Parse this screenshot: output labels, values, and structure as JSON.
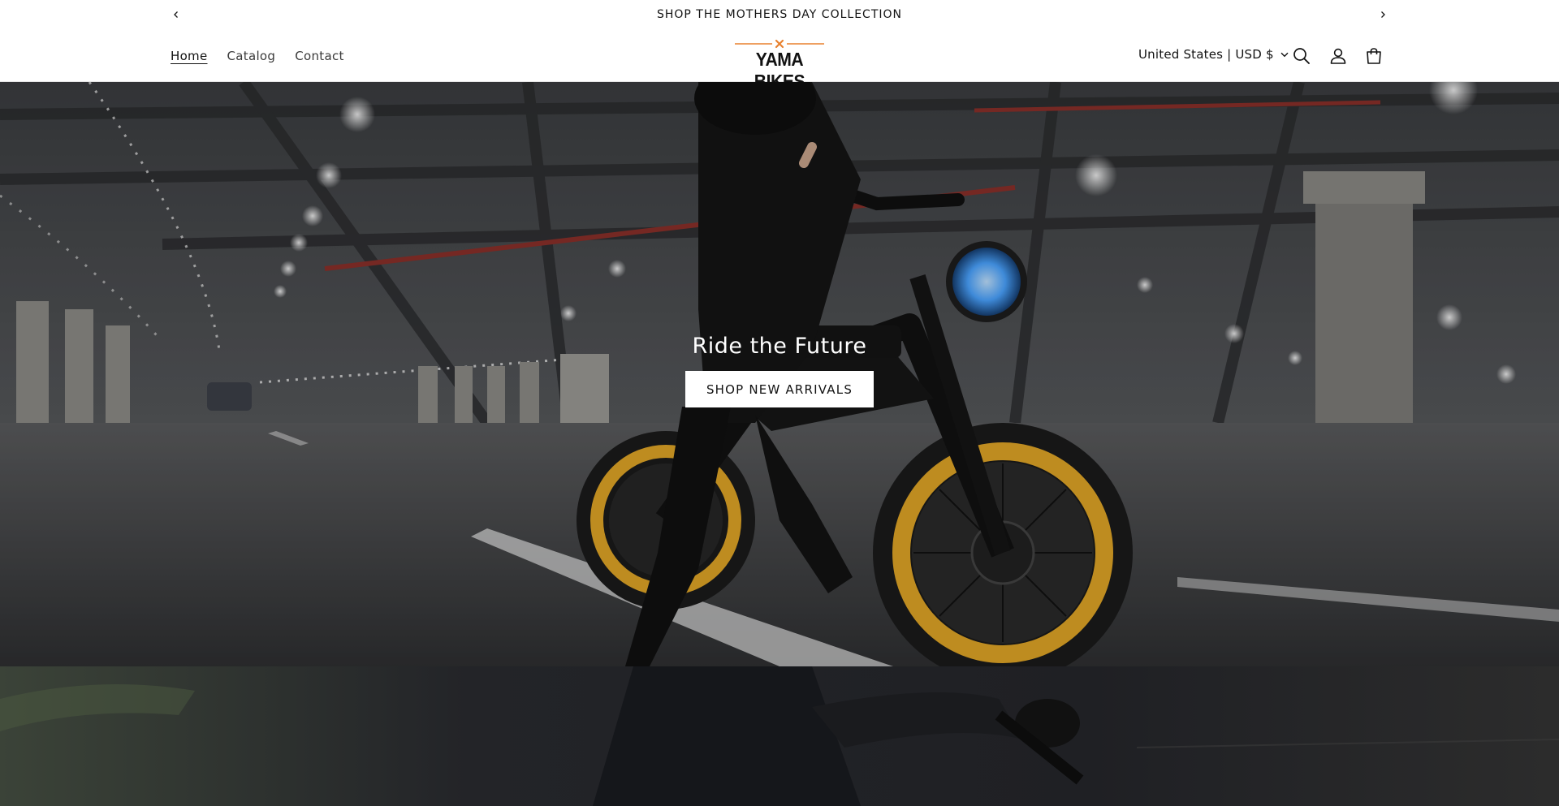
{
  "announcement": {
    "text": "SHOP THE MOTHERS DAY COLLECTION",
    "prev_icon": "chevron-left-icon",
    "next_icon": "chevron-right-icon"
  },
  "header": {
    "nav": [
      {
        "label": "Home",
        "active": true
      },
      {
        "label": "Catalog",
        "active": false
      },
      {
        "label": "Contact",
        "active": false
      }
    ],
    "logo_text": "YAMA BIKES",
    "locale": "United States | USD $",
    "icons": [
      "search-icon",
      "account-icon",
      "cart-icon"
    ]
  },
  "hero": {
    "heading": "Ride the Future",
    "button_label": "SHOP NEW ARRIVALS"
  },
  "colors": {
    "accent_orange": "#e8812f",
    "rim_yellow": "#e0a526",
    "headlight_blue": "#4aa3ff"
  }
}
